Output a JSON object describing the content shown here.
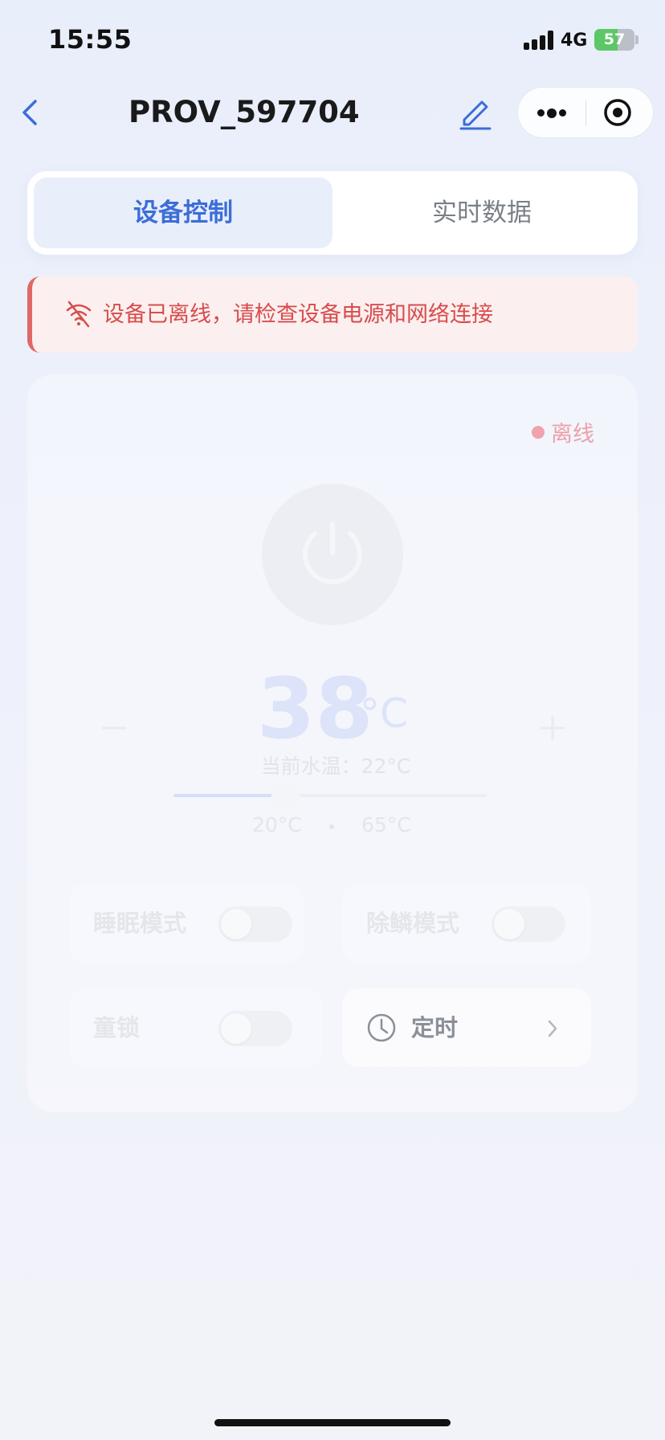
{
  "status_bar": {
    "time": "15:55",
    "network": "4G",
    "battery": "57"
  },
  "nav": {
    "title": "PROV_597704"
  },
  "tabs": [
    {
      "label": "设备控制",
      "active": true
    },
    {
      "label": "实时数据",
      "active": false
    }
  ],
  "alert": {
    "text": "设备已离线，请检查设备电源和网络连接"
  },
  "device": {
    "status": "离线",
    "target_temp": "38",
    "temp_unit": "°C",
    "current_temp_text": "当前水温：22°C",
    "range_min": "20°C",
    "range_max": "65°C",
    "slider_fraction": 0.4
  },
  "options": {
    "sleep_mode": {
      "label": "睡眠模式",
      "on": false
    },
    "descale_mode": {
      "label": "除鳞模式",
      "on": false
    },
    "child_lock": {
      "label": "童锁",
      "on": false
    },
    "timer": {
      "label": "定时"
    }
  },
  "colors": {
    "accent": "#3b6ed8",
    "alert_red": "#d84c4c",
    "offline_pink": "#eca0a8"
  }
}
